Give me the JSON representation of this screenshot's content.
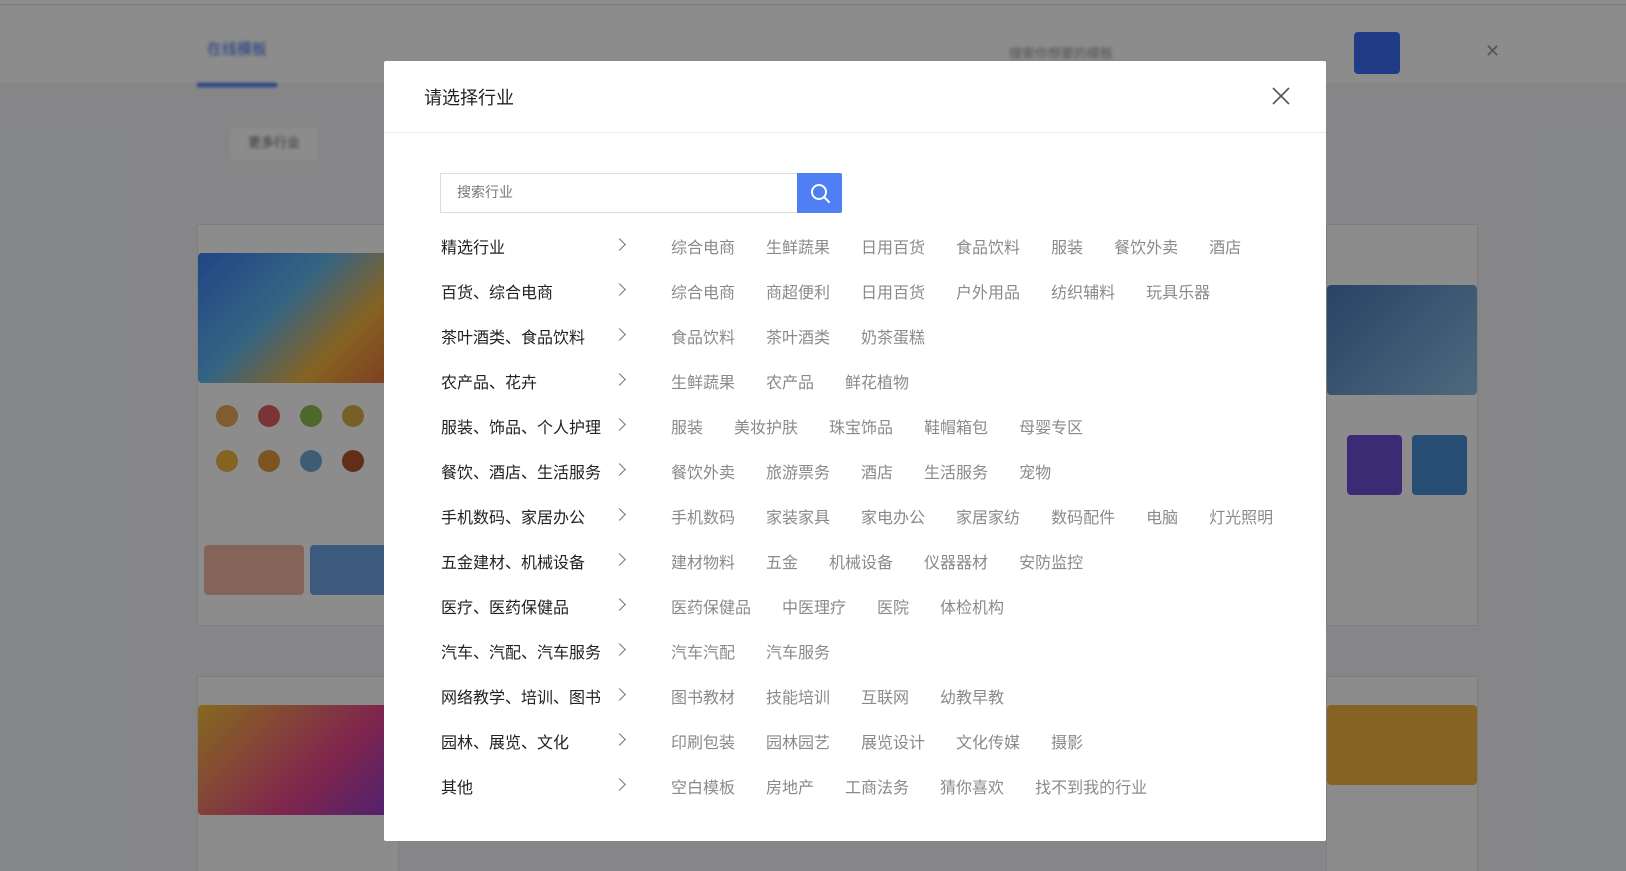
{
  "background": {
    "tab_label": "在线模板",
    "search_placeholder": "搜索你想要的模板",
    "chip_label": "更多行业"
  },
  "modal": {
    "title": "请选择行业",
    "search_placeholder": "搜索行业",
    "rows": [
      {
        "category": "精选行业",
        "subs": [
          "综合电商",
          "生鲜蔬果",
          "日用百货",
          "食品饮料",
          "服装",
          "餐饮外卖",
          "酒店"
        ]
      },
      {
        "category": "百货、综合电商",
        "subs": [
          "综合电商",
          "商超便利",
          "日用百货",
          "户外用品",
          "纺织辅料",
          "玩具乐器"
        ]
      },
      {
        "category": "茶叶酒类、食品饮料",
        "subs": [
          "食品饮料",
          "茶叶酒类",
          "奶茶蛋糕"
        ]
      },
      {
        "category": "农产品、花卉",
        "subs": [
          "生鲜蔬果",
          "农产品",
          "鲜花植物"
        ]
      },
      {
        "category": "服装、饰品、个人护理",
        "subs": [
          "服装",
          "美妆护肤",
          "珠宝饰品",
          "鞋帽箱包",
          "母婴专区"
        ]
      },
      {
        "category": "餐饮、酒店、生活服务",
        "subs": [
          "餐饮外卖",
          "旅游票务",
          "酒店",
          "生活服务",
          "宠物"
        ]
      },
      {
        "category": "手机数码、家居办公",
        "subs": [
          "手机数码",
          "家装家具",
          "家电办公",
          "家居家纺",
          "数码配件",
          "电脑",
          "灯光照明"
        ]
      },
      {
        "category": "五金建材、机械设备",
        "subs": [
          "建材物料",
          "五金",
          "机械设备",
          "仪器器材",
          "安防监控"
        ]
      },
      {
        "category": "医疗、医药保健品",
        "subs": [
          "医药保健品",
          "中医理疗",
          "医院",
          "体检机构"
        ]
      },
      {
        "category": "汽车、汽配、汽车服务",
        "subs": [
          "汽车汽配",
          "汽车服务"
        ]
      },
      {
        "category": "网络教学、培训、图书",
        "subs": [
          "图书教材",
          "技能培训",
          "互联网",
          "幼教早教"
        ]
      },
      {
        "category": "园林、展览、文化",
        "subs": [
          "印刷包装",
          "园林园艺",
          "展览设计",
          "文化传媒",
          "摄影"
        ]
      },
      {
        "category": "其他",
        "subs": [
          "空白模板",
          "房地产",
          "工商法务",
          "猜你喜欢",
          "找不到我的行业"
        ]
      }
    ]
  },
  "colors": {
    "accent": "#4f7ef5",
    "category_text": "#222222",
    "sub_text": "#8a8a8a"
  }
}
